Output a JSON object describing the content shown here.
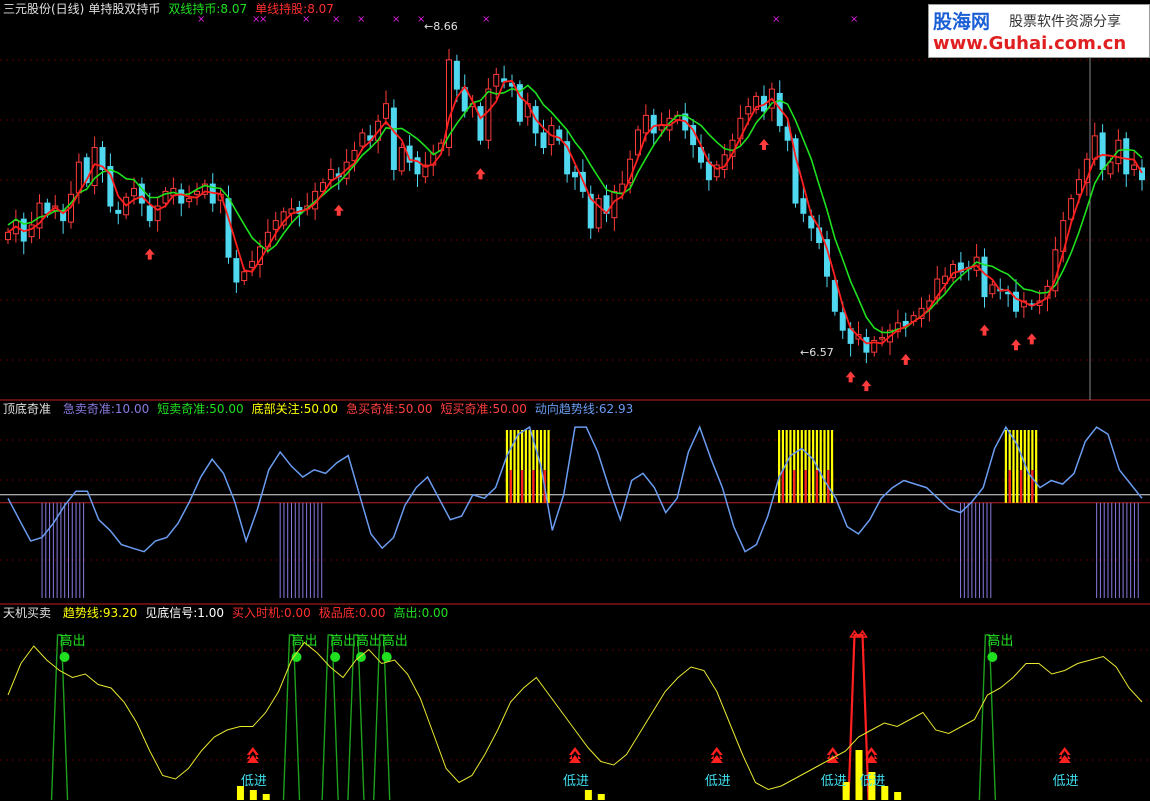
{
  "colors": {
    "up_candle": "#ff3b3b",
    "down_candle": "#4fd8f0",
    "ma_fast": "#ff2020",
    "ma_slow": "#1ee01e",
    "divider": "#c02020",
    "trend_line": "#6a9cf0",
    "zero_line": "#e0e0e0",
    "bottom_purple": "#8a7ae0",
    "signal_yellow": "#ffff00",
    "signal_red": "#ff2020",
    "ss_line": "#e8e830",
    "high_green": "#1ea01e",
    "high_dot": "#20e020",
    "low_red": "#ff2020",
    "low_text": "#40e0f0",
    "magenta": "#e020e0"
  },
  "logo": {
    "brand": "股海网",
    "slogan": "股票软件资源分享",
    "url": "www.Guhai.com.cn"
  },
  "main_panel": {
    "stock_title": "三元股份(日线)",
    "indicator_name": "单持股双持币",
    "dual_label": "双线持币:8.07",
    "single_label": "单线持股:8.07",
    "max_label": "8.66",
    "min_label": "6.57"
  },
  "mid_panel": {
    "name": "顶底奇准",
    "items": [
      {
        "label": "急卖奇准:10.00",
        "color": "#8a7ae0"
      },
      {
        "label": "短卖奇准:50.00",
        "color": "#20e020"
      },
      {
        "label": "底部关注:50.00",
        "color": "#ffff00"
      },
      {
        "label": "急买奇准:50.00",
        "color": "#ff4040"
      },
      {
        "label": "短买奇准:50.00",
        "color": "#ff4040"
      },
      {
        "label": "动向趋势线:62.93",
        "color": "#6a9cf0"
      }
    ]
  },
  "bottom_panel": {
    "name": "天机买卖",
    "items": [
      {
        "label": "趋势线:93.20",
        "color": "#ffff00"
      },
      {
        "label": "见底信号:1.00",
        "color": "#ffffff"
      },
      {
        "label": "买入时机:0.00",
        "color": "#ff3030"
      },
      {
        "label": "极品底:0.00",
        "color": "#ff3030"
      },
      {
        "label": "高出:0.00",
        "color": "#20e020"
      }
    ],
    "high_text": "高出",
    "low_text": "低进"
  },
  "chart_data": [
    {
      "type": "candlestick",
      "title": "三元股份(日线)",
      "ylim": [
        6.3,
        8.9
      ],
      "max_value": 8.66,
      "min_value": 6.57,
      "close": [
        7.42,
        7.5,
        7.36,
        7.47,
        7.62,
        7.55,
        7.6,
        7.5,
        7.68,
        7.9,
        7.76,
        8.0,
        7.85,
        7.6,
        7.55,
        7.66,
        7.72,
        7.62,
        7.5,
        7.6,
        7.7,
        7.72,
        7.62,
        7.65,
        7.7,
        7.75,
        7.62,
        7.68,
        7.25,
        7.08,
        7.15,
        7.22,
        7.32,
        7.42,
        7.5,
        7.56,
        7.58,
        7.55,
        7.6,
        7.7,
        7.76,
        7.85,
        7.8,
        7.9,
        7.98,
        8.1,
        8.05,
        8.18,
        8.3,
        7.85,
        8.0,
        7.9,
        7.82,
        7.88,
        7.96,
        8.03,
        8.6,
        8.4,
        8.25,
        8.3,
        8.05,
        8.4,
        8.5,
        8.45,
        8.42,
        8.18,
        8.3,
        8.1,
        8.0,
        8.15,
        8.05,
        7.82,
        7.8,
        7.7,
        7.45,
        7.65,
        7.55,
        7.7,
        7.75,
        7.92,
        8.12,
        8.22,
        8.1,
        8.15,
        8.2,
        8.22,
        8.12,
        8.02,
        7.9,
        7.78,
        7.88,
        7.95,
        8.05,
        8.2,
        8.28,
        8.35,
        8.25,
        8.4,
        8.15,
        8.05,
        7.62,
        7.55,
        7.45,
        7.35,
        7.12,
        6.88,
        6.75,
        6.66,
        6.72,
        6.6,
        6.68,
        6.7,
        6.75,
        6.8,
        6.78,
        6.85,
        6.9,
        6.95,
        7.1,
        7.12,
        7.2,
        7.15,
        7.18,
        7.25,
        6.98,
        7.06,
        7.02,
        7.0,
        6.88,
        6.95,
        6.92,
        6.95,
        7.05,
        7.3,
        7.5,
        7.65,
        7.78,
        7.92,
        8.08,
        7.85,
        7.9,
        8.05,
        7.82,
        7.88,
        7.78
      ]
    },
    {
      "type": "line",
      "title": "顶底奇准",
      "series": [
        {
          "name": "动向趋势线",
          "values": [
            56,
            44,
            32,
            34,
            42,
            52,
            60,
            60,
            44,
            38,
            30,
            28,
            26,
            32,
            34,
            42,
            54,
            68,
            78,
            70,
            54,
            32,
            50,
            72,
            82,
            74,
            68,
            72,
            70,
            76,
            80,
            58,
            36,
            28,
            34,
            52,
            62,
            68,
            56,
            44,
            46,
            58,
            56,
            62,
            80,
            92,
            96,
            74,
            38,
            58,
            96,
            96,
            82,
            62,
            44,
            66,
            70,
            62,
            48,
            56,
            82,
            96,
            78,
            62,
            40,
            26,
            30,
            46,
            68,
            80,
            84,
            78,
            66,
            56,
            40,
            36,
            44,
            56,
            62,
            66,
            64,
            62,
            56,
            50,
            48,
            54,
            62,
            84,
            96,
            86,
            70,
            62,
            66,
            64,
            70,
            88,
            96,
            92,
            72,
            64,
            56
          ]
        },
        {
          "name": "急卖奇准",
          "values": [
            0,
            0,
            0,
            1,
            1,
            1,
            1,
            0,
            0,
            0,
            0,
            0,
            0,
            0,
            0,
            0,
            0,
            0,
            0,
            0,
            0,
            0,
            0,
            0,
            1,
            1,
            1,
            1,
            0,
            0,
            0,
            0,
            0,
            0,
            0,
            0,
            0,
            0,
            0,
            0,
            0,
            0,
            0,
            0,
            0,
            0,
            0,
            0,
            0,
            0,
            0,
            0,
            0,
            0,
            0,
            0,
            0,
            0,
            0,
            0,
            0,
            0,
            0,
            0,
            0,
            0,
            0,
            0,
            0,
            0,
            0,
            0,
            0,
            0,
            0,
            0,
            0,
            0,
            0,
            0,
            0,
            0,
            0,
            0,
            1,
            1,
            1,
            0,
            0,
            0,
            0,
            0,
            0,
            0,
            0,
            0,
            1,
            1,
            1,
            1,
            0
          ]
        },
        {
          "name": "底部关注",
          "values": [
            0,
            0,
            0,
            0,
            0,
            0,
            0,
            0,
            0,
            0,
            0,
            0,
            0,
            0,
            0,
            0,
            0,
            0,
            0,
            0,
            0,
            0,
            0,
            0,
            0,
            0,
            0,
            0,
            0,
            0,
            0,
            0,
            0,
            0,
            0,
            0,
            0,
            0,
            0,
            0,
            0,
            0,
            0,
            0,
            1,
            1,
            1,
            1,
            0,
            0,
            0,
            0,
            0,
            0,
            0,
            0,
            0,
            0,
            0,
            0,
            0,
            0,
            0,
            0,
            0,
            0,
            0,
            0,
            1,
            1,
            1,
            1,
            1,
            0,
            0,
            0,
            0,
            0,
            0,
            0,
            0,
            0,
            0,
            0,
            0,
            0,
            0,
            0,
            1,
            1,
            1,
            0,
            0,
            0,
            0,
            0,
            0,
            0,
            0,
            0,
            0
          ]
        }
      ]
    },
    {
      "type": "line",
      "title": "天机买卖",
      "series": [
        {
          "name": "趋势线",
          "values": [
            60,
            78,
            88,
            80,
            74,
            70,
            72,
            66,
            64,
            56,
            44,
            28,
            14,
            12,
            18,
            28,
            36,
            40,
            42,
            42,
            50,
            62,
            80,
            90,
            84,
            76,
            70,
            80,
            86,
            78,
            80,
            72,
            58,
            38,
            18,
            10,
            14,
            26,
            40,
            56,
            64,
            70,
            60,
            50,
            40,
            30,
            22,
            20,
            26,
            38,
            50,
            62,
            70,
            76,
            74,
            62,
            44,
            26,
            10,
            6,
            8,
            12,
            16,
            20,
            24,
            28,
            36,
            40,
            44,
            42,
            46,
            50,
            40,
            38,
            42,
            46,
            60,
            64,
            70,
            78,
            78,
            72,
            74,
            78,
            80,
            82,
            76,
            64,
            56
          ]
        },
        {
          "name": "高出",
          "values": [
            0,
            0,
            0,
            0,
            1,
            0,
            0,
            0,
            0,
            0,
            0,
            0,
            0,
            0,
            0,
            0,
            0,
            0,
            0,
            0,
            0,
            0,
            1,
            0,
            0,
            1,
            0,
            1,
            0,
            1,
            0,
            0,
            0,
            0,
            0,
            0,
            0,
            0,
            0,
            0,
            0,
            0,
            0,
            0,
            0,
            0,
            0,
            0,
            0,
            0,
            0,
            0,
            0,
            0,
            0,
            0,
            0,
            0,
            0,
            0,
            0,
            0,
            0,
            0,
            0,
            0,
            0,
            0,
            0,
            0,
            0,
            0,
            0,
            0,
            0,
            0,
            1,
            0,
            0,
            0,
            0,
            0,
            0,
            0,
            0,
            0,
            0,
            0,
            0
          ]
        },
        {
          "name": "见底信号",
          "values": [
            0,
            0,
            0,
            0,
            0,
            0,
            0,
            0,
            0,
            0,
            0,
            0,
            0,
            0,
            0,
            0,
            0,
            0,
            0,
            0,
            0,
            0,
            0,
            0,
            0,
            0,
            0,
            0,
            0,
            0,
            0,
            0,
            0,
            0,
            0,
            0,
            0,
            0,
            0,
            0,
            0,
            0,
            0,
            0,
            0,
            0,
            0,
            0,
            0,
            0,
            0,
            0,
            0,
            0,
            0,
            0,
            0,
            0,
            0,
            0,
            0,
            0,
            0,
            0,
            0,
            0,
            0,
            0,
            0,
            0,
            0,
            0,
            0,
            0,
            0,
            0,
            0,
            0,
            0,
            0,
            0,
            0,
            0,
            0,
            0,
            0,
            0,
            0,
            0
          ]
        },
        {
          "name": "低进",
          "values": [
            0,
            0,
            0,
            0,
            0,
            0,
            0,
            0,
            0,
            0,
            0,
            0,
            0,
            0,
            0,
            0,
            0,
            0,
            0,
            0,
            0,
            0,
            0,
            0,
            0,
            0,
            0,
            0,
            0,
            0,
            0,
            0,
            0,
            0,
            0,
            0,
            0,
            0,
            0,
            0,
            0,
            0,
            0,
            0,
            0,
            0,
            0,
            0,
            0,
            0,
            0,
            0,
            0,
            0,
            0,
            0,
            0,
            0,
            0,
            0,
            0,
            0,
            0,
            0,
            0,
            0,
            0,
            0,
            0,
            0,
            0,
            0,
            0,
            0,
            0,
            0,
            0,
            0,
            0,
            0,
            0,
            0,
            0,
            0,
            0,
            0,
            0,
            0,
            0
          ]
        }
      ]
    }
  ]
}
